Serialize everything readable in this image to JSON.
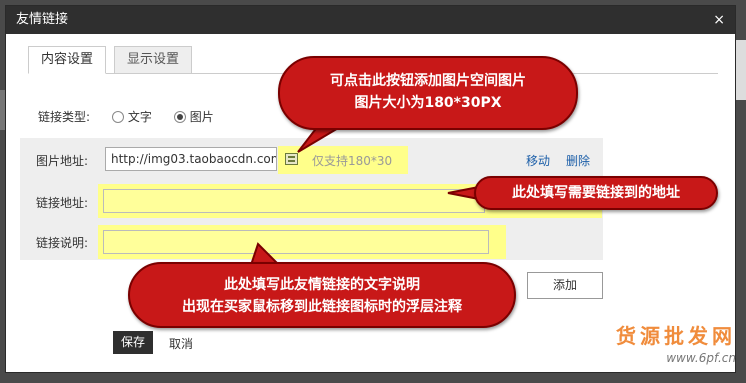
{
  "dialog": {
    "title": "友情链接",
    "close_glyph": "×",
    "tabs": [
      {
        "label": "内容设置"
      },
      {
        "label": "显示设置"
      }
    ]
  },
  "link_type": {
    "label": "链接类型:",
    "options": [
      {
        "label": "文字"
      },
      {
        "label": "图片"
      }
    ],
    "selected": "图片"
  },
  "fields": {
    "image_label": "图片地址:",
    "image_value": "http://img03.taobaocdn.com/",
    "image_hint": "仅支持180*30",
    "move_label": "移动",
    "delete_label": "删除",
    "url_label": "链接地址:",
    "url_value": "",
    "desc_label": "链接说明:",
    "desc_value": ""
  },
  "buttons": {
    "add": "添加",
    "save": "保存",
    "cancel": "取消"
  },
  "callouts": {
    "c1_line1": "可点击此按钮添加图片空间图片",
    "c1_line2": "图片大小为180*30PX",
    "c2": "此处填写需要链接到的地址",
    "c3_line1": "此处填写此友情链接的文字说明",
    "c3_line2": "出现在买家鼠标移到此链接图标时的浮层注释"
  },
  "watermark": {
    "cn": "货源批发网",
    "url": "www.6pf.cn"
  },
  "colors": {
    "highlight": "#ffff8a",
    "callout": "#c81818",
    "titlebar": "#2f2f2f",
    "link": "#1b5ea8"
  }
}
